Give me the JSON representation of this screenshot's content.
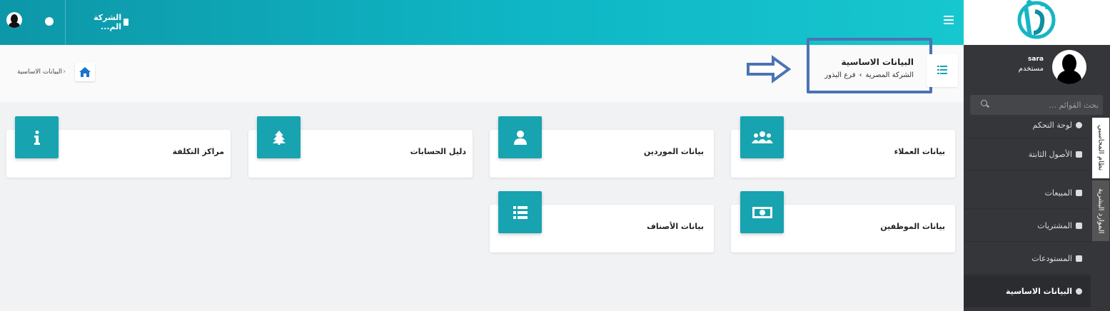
{
  "topbar": {
    "company": "الشركة الم...",
    "colors": {
      "start": "#0d97a8",
      "end": "#17c7cf"
    }
  },
  "sidebar": {
    "user_name": "sara",
    "user_role": "مستخدم",
    "search_placeholder": "بحث القوائم ...",
    "items": [
      {
        "label": "لوحة التحكم",
        "icon": "dashboard-icon"
      },
      {
        "label": "الأصول الثابتة",
        "icon": "file-icon"
      },
      {
        "label": "المبيعات",
        "icon": "truck-icon"
      },
      {
        "label": "المشتريات",
        "icon": "money-icon"
      },
      {
        "label": "المستودعات",
        "icon": "archive-icon"
      },
      {
        "label": "البيانات الاساسية",
        "icon": "info-icon"
      }
    ],
    "vertical_tabs": [
      "نظام المحاسبي",
      "الموارد البشرية"
    ]
  },
  "breadcrumb": {
    "current": "البيانات الاساسية"
  },
  "page": {
    "title": "البيانات الاساسية",
    "company": "الشركة المصرية",
    "branch": "فرع البذور"
  },
  "cards": [
    {
      "label": "بيانات العملاء",
      "icon": "users-icon"
    },
    {
      "label": "بيانات الموردين",
      "icon": "user-icon"
    },
    {
      "label": "دليل الحسابات",
      "icon": "tree-icon"
    },
    {
      "label": "مراكز التكلفة",
      "icon": "info-icon"
    },
    {
      "label": "بيانات الموظفين",
      "icon": "money-bill-icon"
    },
    {
      "label": "بيانات الأصناف",
      "icon": "list-icon"
    }
  ],
  "accent": "#17a3b0",
  "annotation_color": "#4a74b4"
}
